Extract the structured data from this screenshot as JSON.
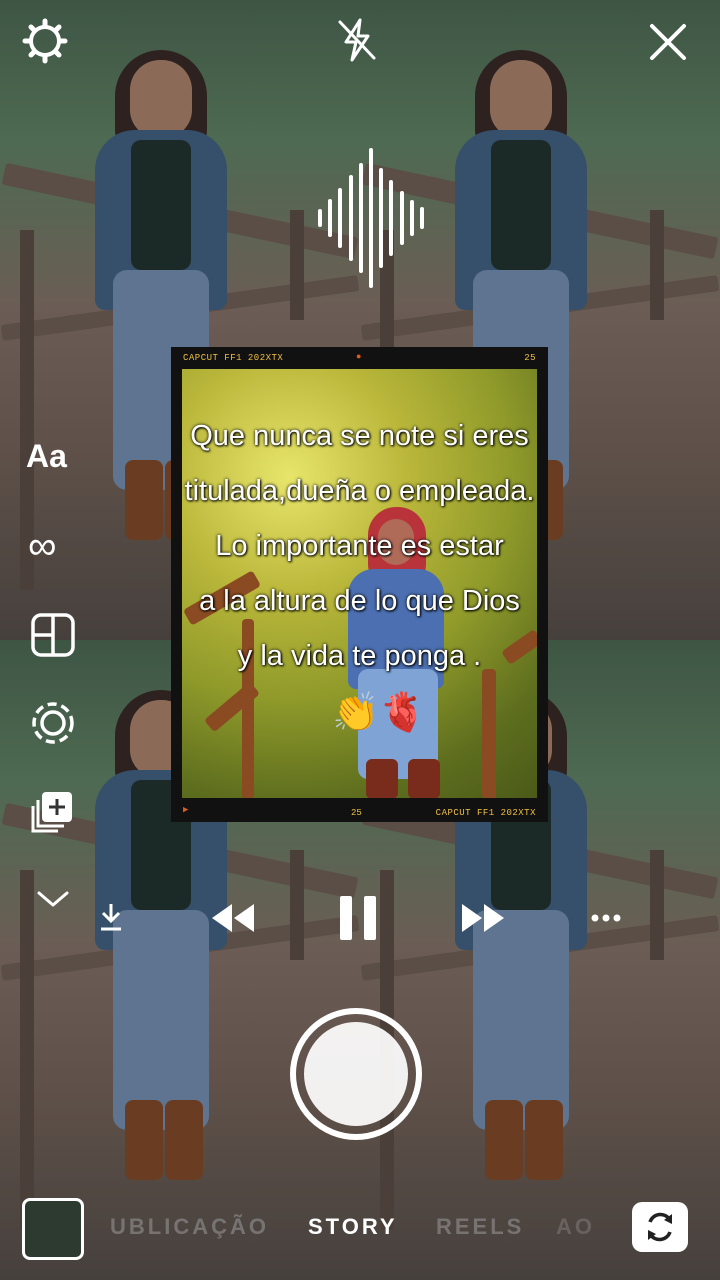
{
  "top_bar": {
    "settings_icon": "gear-icon",
    "flash_icon": "flash-off-icon",
    "close_icon": "close-icon"
  },
  "audio_icon": "audio-waveform-icon",
  "left_tools": [
    {
      "name": "text-tool",
      "label": "Aa",
      "icon": "text-icon"
    },
    {
      "name": "boomerang-tool",
      "label": "∞",
      "icon": "infinity-icon"
    },
    {
      "name": "layout-tool",
      "label": "",
      "icon": "layout-icon"
    },
    {
      "name": "hands-free-tool",
      "label": "",
      "icon": "hands-free-icon"
    },
    {
      "name": "multi-capture-tool",
      "label": "",
      "icon": "multi-capture-icon"
    },
    {
      "name": "more-tools",
      "label": "",
      "icon": "chevron-down-icon"
    }
  ],
  "card": {
    "top_left": "CAPCUT FF1 202XTX",
    "top_right": "25",
    "bottom_mid": "25",
    "bottom_right": "CAPCUT FF1 202XTX",
    "caption_lines": [
      "Que nunca se note si eres",
      "titulada,dueña o empleada.",
      "Lo importante es estar",
      "a la altura de lo que Dios",
      "y la vida te ponga ."
    ],
    "emoji": "👏🫀"
  },
  "playback": {
    "download_icon": "download-icon",
    "rewind_icon": "rewind-icon",
    "pause_icon": "pause-icon",
    "forward_icon": "fast-forward-icon",
    "more_icon": "more-icon"
  },
  "modes": {
    "publicacao": "UBLICAÇÃO",
    "story": "STORY",
    "reels": "REELS",
    "ao": "AO"
  },
  "colors": {
    "active_mode": "#ffffff",
    "inactive_mode": "#9a9a9a",
    "film_text": "#f0c040"
  }
}
